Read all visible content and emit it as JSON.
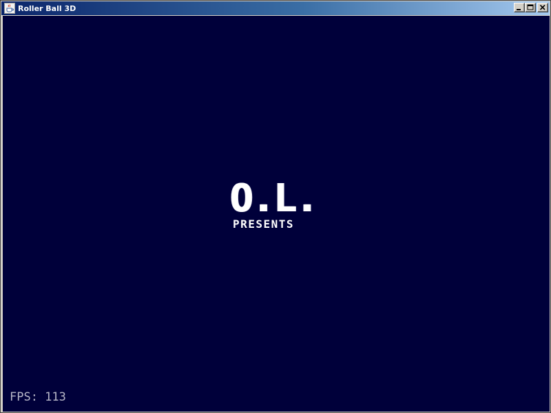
{
  "window": {
    "title": "Roller Ball 3D",
    "icon": "java-cup-icon",
    "controls": [
      "minimize",
      "maximize",
      "close"
    ]
  },
  "splash": {
    "logo": "O.L.",
    "subtitle": "PRESENTS"
  },
  "hud": {
    "fps_label": "FPS: 113"
  },
  "colors": {
    "canvas_background": "#00003a",
    "logo_text": "#ffffff",
    "fps_text": "#b8b8c8",
    "titlebar_start": "#0a246a",
    "titlebar_end": "#a6caf0"
  }
}
